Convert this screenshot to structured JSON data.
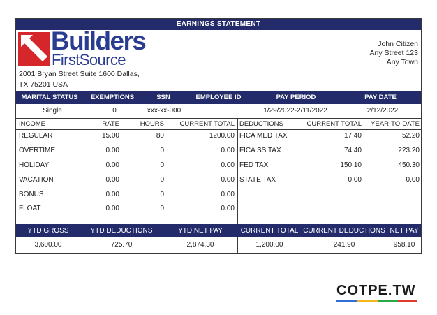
{
  "header": {
    "title": "EARNINGS STATEMENT"
  },
  "company": {
    "logo_word1": "Builders",
    "logo_word2a": "First",
    "logo_word2b": "Source",
    "address_line1": "2001 Bryan Street Suite 1600 Dallas,",
    "address_line2": "TX 75201 USA"
  },
  "employee": {
    "name": "John Citizen",
    "street": "Any Street 123",
    "town": "Any Town"
  },
  "info": {
    "headers": [
      "MARITAL STATUS",
      "EXEMPTIONS",
      "SSN",
      "EMPLOYEE ID",
      "PAY PERIOD",
      "PAY DATE"
    ],
    "values": [
      "Single",
      "0",
      "xxx-xx-000",
      "",
      "1/29/2022-2/11/2022",
      "2/12/2022"
    ]
  },
  "income": {
    "headers": [
      "INCOME",
      "RATE",
      "HOURS",
      "CURRENT TOTAL"
    ],
    "rows": [
      [
        "REGULAR",
        "15.00",
        "80",
        "1200.00"
      ],
      [
        "OVERTIME",
        "0.00",
        "0",
        "0.00"
      ],
      [
        "HOLIDAY",
        "0.00",
        "0",
        "0.00"
      ],
      [
        "VACATION",
        "0.00",
        "0",
        "0.00"
      ],
      [
        "BONUS",
        "0.00",
        "0",
        "0.00"
      ],
      [
        "FLOAT",
        "0.00",
        "0",
        "0.00"
      ]
    ]
  },
  "deductions": {
    "headers": [
      "DEDUCTIONS",
      "CURRENT TOTAL",
      "YEAR-TO-DATE"
    ],
    "rows": [
      [
        "FICA MED TAX",
        "17.40",
        "52.20"
      ],
      [
        "FICA SS TAX",
        "74.40",
        "223.20"
      ],
      [
        "FED TAX",
        "150.10",
        "450.30"
      ],
      [
        "STATE TAX",
        "0.00",
        "0.00"
      ]
    ]
  },
  "summary": {
    "headers": [
      "YTD GROSS",
      "YTD DEDUCTIONS",
      "YTD NET PAY",
      "CURRENT TOTAL",
      "CURRENT DEDUCTIONS",
      "NET PAY"
    ],
    "values": [
      "3,600.00",
      "725.70",
      "2,874.30",
      "1,200.00",
      "241.90",
      "958.10"
    ]
  },
  "watermark": {
    "text": "COTPE.TW"
  },
  "colors": {
    "band": "#242b6b",
    "logo_blue": "#2a3c8f",
    "logo_red": "#d5262b"
  }
}
